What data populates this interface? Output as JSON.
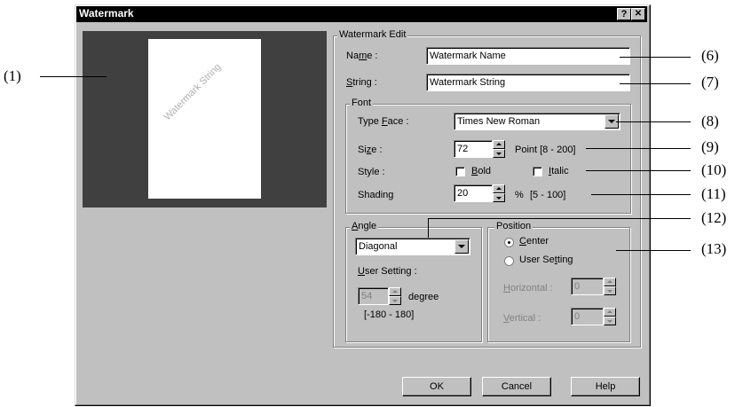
{
  "window": {
    "title": "Watermark",
    "help_btn": "?",
    "close_btn": "✕"
  },
  "preview": {
    "watermark_text": "Watermark String"
  },
  "edit": {
    "group_label": "Watermark Edit",
    "name_label_pre": "Na",
    "name_label_ul": "m",
    "name_label_post": "e :",
    "name_value": "Watermark Name",
    "string_label_ul": "S",
    "string_label_post": "tring :",
    "string_value": "Watermark String"
  },
  "font": {
    "group_label": "Font",
    "typeface_label_pre": "Type ",
    "typeface_label_ul": "F",
    "typeface_label_post": "ace :",
    "typeface_value": "Times New Roman",
    "size_label_pre": "Si",
    "size_label_ul": "z",
    "size_label_post": "e :",
    "size_value": "72",
    "size_range": "Point [8 - 200]",
    "style_label": "Style :",
    "bold_label_ul": "B",
    "bold_label_post": "old",
    "italic_label_ul": "I",
    "italic_label_post": "talic",
    "shading_label_pre": "Shadin",
    "shading_label_ul": "g",
    "shading_value": "20",
    "shading_unit": "%",
    "shading_range": "[5 - 100]"
  },
  "angle": {
    "group_label_ul": "A",
    "group_label_post": "ngle",
    "select_value": "Diagonal",
    "user_label_ul": "U",
    "user_label_post": "ser Setting :",
    "degree_value": "54",
    "degree_label": "degree",
    "degree_range": "[-180 - 180]"
  },
  "position": {
    "group_label": "Position",
    "center_ul": "C",
    "center_post": "enter",
    "user_pre": "User Se",
    "user_ul": "t",
    "user_post": "ting",
    "horizontal_ul": "H",
    "horizontal_post": "orizontal :",
    "horizontal_value": "0",
    "vertical_ul": "V",
    "vertical_post": "ertical :",
    "vertical_value": "0"
  },
  "buttons": {
    "ok": "OK",
    "cancel": "Cancel",
    "help": "Help"
  },
  "callouts": {
    "c1": "(1)",
    "c6": "(6)",
    "c7": "(7)",
    "c8": "(8)",
    "c9": "(9)",
    "c10": "(10)",
    "c11": "(11)",
    "c12": "(12)",
    "c13": "(13)"
  }
}
